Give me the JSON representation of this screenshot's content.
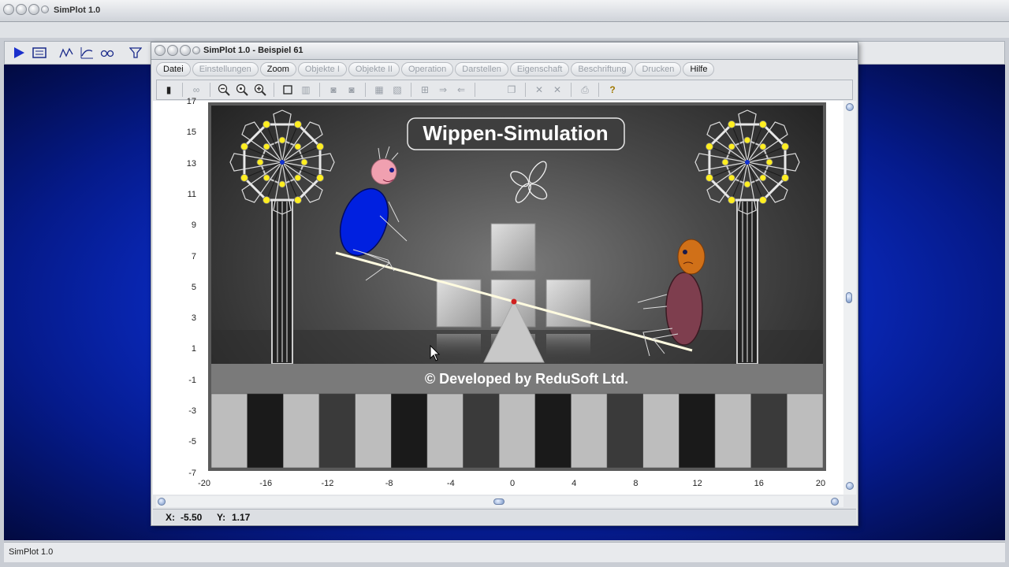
{
  "outer_window": {
    "title": "SimPlot 1.0"
  },
  "outer_status": {
    "text": "SimPlot 1.0"
  },
  "outer_toolbar": {
    "icons": [
      "play-icon",
      "calculator-icon",
      "function-plot-icon",
      "curve-icon",
      "oo-icon",
      "filter-icon"
    ]
  },
  "inner_window": {
    "title": "SimPlot 1.0 - Beispiel 61"
  },
  "menu": [
    {
      "label": "Datei",
      "enabled": true
    },
    {
      "label": "Einstellungen",
      "enabled": false
    },
    {
      "label": "Zoom",
      "enabled": true
    },
    {
      "label": "Objekte I",
      "enabled": false
    },
    {
      "label": "Objekte II",
      "enabled": false
    },
    {
      "label": "Operation",
      "enabled": false
    },
    {
      "label": "Darstellen",
      "enabled": false
    },
    {
      "label": "Eigenschaft",
      "enabled": false
    },
    {
      "label": "Beschriftung",
      "enabled": false
    },
    {
      "label": "Drucken",
      "enabled": false
    },
    {
      "label": "Hilfe",
      "enabled": true
    }
  ],
  "axes": {
    "x_ticks": [
      "-20",
      "-16",
      "-12",
      "-8",
      "-4",
      "0",
      "4",
      "8",
      "12",
      "16",
      "20"
    ],
    "y_ticks": [
      "17",
      "15",
      "13",
      "11",
      "9",
      "7",
      "5",
      "3",
      "1",
      "-1",
      "-3",
      "-5",
      "-7"
    ]
  },
  "scene": {
    "title": "Wippen-Simulation",
    "banner": "© Developed by ReduSoft Ltd."
  },
  "status": {
    "x_label": "X:",
    "x_value": "-5.50",
    "y_label": "Y:",
    "y_value": "1.17"
  }
}
